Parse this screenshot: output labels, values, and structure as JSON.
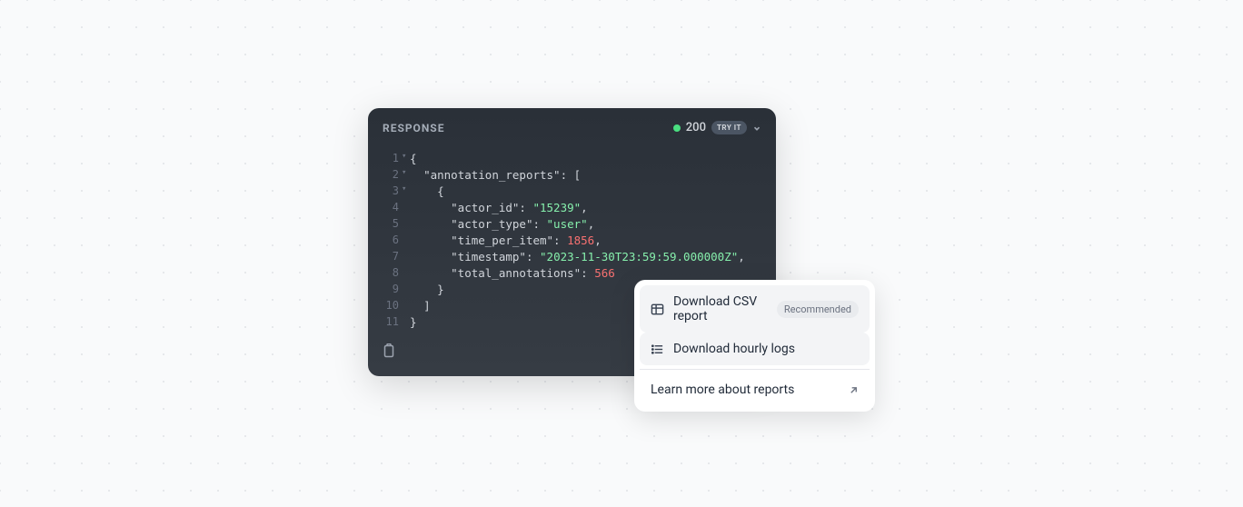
{
  "panel": {
    "title": "RESPONSE",
    "status_code": "200",
    "try_it_label": "TRY IT"
  },
  "code": {
    "lines": [
      {
        "num": "1",
        "fold": "▾",
        "indent": "",
        "tokens": [
          {
            "t": "punct",
            "v": "{"
          }
        ]
      },
      {
        "num": "2",
        "fold": "▾",
        "indent": "  ",
        "tokens": [
          {
            "t": "key",
            "v": "\"annotation_reports\""
          },
          {
            "t": "punct",
            "v": ": ["
          }
        ]
      },
      {
        "num": "3",
        "fold": "▾",
        "indent": "    ",
        "tokens": [
          {
            "t": "punct",
            "v": "{"
          }
        ]
      },
      {
        "num": "4",
        "fold": "",
        "indent": "      ",
        "tokens": [
          {
            "t": "key",
            "v": "\"actor_id\""
          },
          {
            "t": "punct",
            "v": ": "
          },
          {
            "t": "str",
            "v": "\"15239\""
          },
          {
            "t": "punct",
            "v": ","
          }
        ]
      },
      {
        "num": "5",
        "fold": "",
        "indent": "      ",
        "tokens": [
          {
            "t": "key",
            "v": "\"actor_type\""
          },
          {
            "t": "punct",
            "v": ": "
          },
          {
            "t": "str",
            "v": "\"user\""
          },
          {
            "t": "punct",
            "v": ","
          }
        ]
      },
      {
        "num": "6",
        "fold": "",
        "indent": "      ",
        "tokens": [
          {
            "t": "key",
            "v": "\"time_per_item\""
          },
          {
            "t": "punct",
            "v": ": "
          },
          {
            "t": "num",
            "v": "1856"
          },
          {
            "t": "punct",
            "v": ","
          }
        ]
      },
      {
        "num": "7",
        "fold": "",
        "indent": "      ",
        "tokens": [
          {
            "t": "key",
            "v": "\"timestamp\""
          },
          {
            "t": "punct",
            "v": ": "
          },
          {
            "t": "str",
            "v": "\"2023-11-30T23:59:59.000000Z\""
          },
          {
            "t": "punct",
            "v": ","
          }
        ]
      },
      {
        "num": "8",
        "fold": "",
        "indent": "      ",
        "tokens": [
          {
            "t": "key",
            "v": "\"total_annotations\""
          },
          {
            "t": "punct",
            "v": ": "
          },
          {
            "t": "num",
            "v": "566"
          }
        ]
      },
      {
        "num": "9",
        "fold": "",
        "indent": "    ",
        "tokens": [
          {
            "t": "punct",
            "v": "}"
          }
        ]
      },
      {
        "num": "10",
        "fold": "",
        "indent": "  ",
        "tokens": [
          {
            "t": "punct",
            "v": "]"
          }
        ]
      },
      {
        "num": "11",
        "fold": "",
        "indent": "",
        "tokens": [
          {
            "t": "punct",
            "v": "}"
          }
        ]
      }
    ]
  },
  "menu": {
    "items": [
      {
        "icon": "table",
        "label": "Download CSV report",
        "badge": "Recommended",
        "highlighted": true
      },
      {
        "icon": "list",
        "label": "Download hourly logs",
        "highlighted": true
      }
    ],
    "link": {
      "label": "Learn more about reports"
    }
  }
}
